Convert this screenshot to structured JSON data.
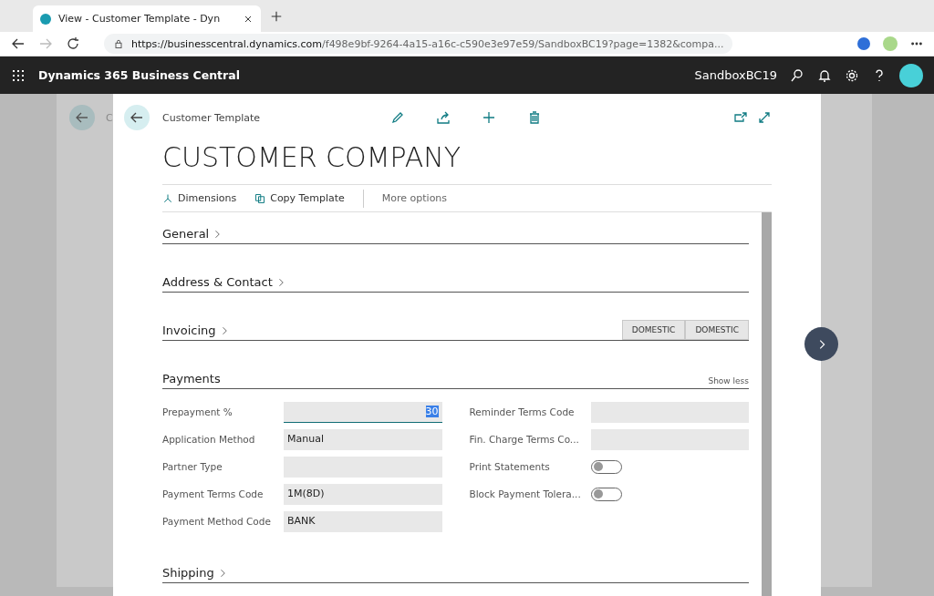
{
  "browser": {
    "tab_title": "View - Customer Template - Dyn",
    "url_host": "https://businesscentral.dynamics.com",
    "url_rest": "/f498e9bf-9264-4a15-a16c-c590e3e97e59/SandboxBC19?page=1382&compa..."
  },
  "app_bar": {
    "title": "Dynamics 365 Business Central",
    "environment": "SandboxBC19"
  },
  "background_page": {
    "title": "C"
  },
  "dialog": {
    "caption": "Customer Template",
    "title": "CUSTOMER COMPANY",
    "actions": [
      {
        "label": "Dimensions",
        "kind": "dimensions"
      },
      {
        "label": "Copy Template",
        "kind": "copy"
      },
      {
        "label": "More options",
        "kind": "more"
      }
    ],
    "sections": [
      {
        "title": "General",
        "expanded": false
      },
      {
        "title": "Address & Contact",
        "expanded": false
      },
      {
        "title": "Invoicing",
        "expanded": false,
        "tags": [
          "DOMESTIC",
          "DOMESTIC"
        ]
      },
      {
        "title": "Payments",
        "expanded": true,
        "toggle_label": "Show less",
        "left_fields": [
          {
            "label": "Prepayment %",
            "kind": "text",
            "value": "30",
            "numeric": true,
            "selected": true
          },
          {
            "label": "Application Method",
            "kind": "text",
            "value": "Manual",
            "numeric": false,
            "selected": false
          },
          {
            "label": "Partner Type",
            "kind": "text",
            "numeric": false,
            "selected": false
          },
          {
            "label": "Payment Terms Code",
            "kind": "text",
            "value": "1M(8D)",
            "numeric": false,
            "selected": false
          },
          {
            "label": "Payment Method Code",
            "kind": "text",
            "value": "BANK",
            "numeric": false,
            "selected": false
          }
        ],
        "right_fields": [
          {
            "label": "Reminder Terms Code",
            "kind": "text",
            "numeric": false,
            "selected": false
          },
          {
            "label": "Fin. Charge Terms Co...",
            "kind": "text",
            "numeric": false,
            "selected": false
          },
          {
            "label": "Print Statements",
            "kind": "toggle",
            "on": false
          },
          {
            "label": "Block Payment Tolera...",
            "kind": "toggle",
            "on": false
          }
        ]
      },
      {
        "title": "Shipping",
        "expanded": false
      }
    ]
  }
}
